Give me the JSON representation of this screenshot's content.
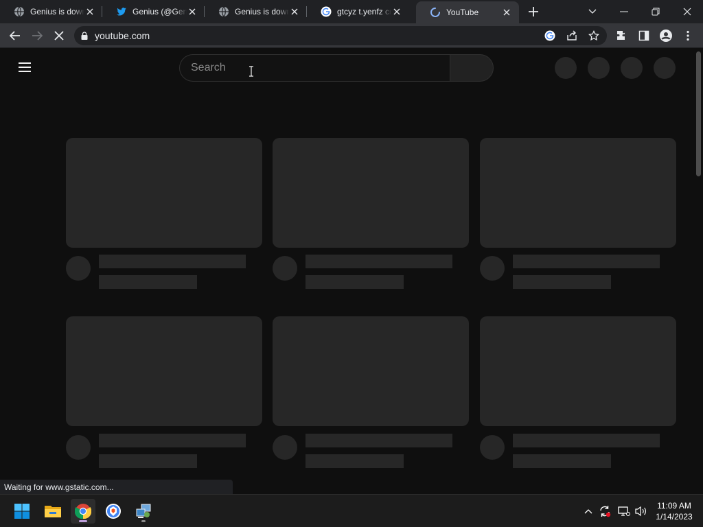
{
  "browser": {
    "tabs": [
      {
        "title": "Genius is down",
        "icon": "globe-icon"
      },
      {
        "title": "Genius (@Genius) / Twitter",
        "icon": "twitter-icon"
      },
      {
        "title": "Genius is down",
        "icon": "globe-icon"
      },
      {
        "title": "gtcyz t.yenfz crfs",
        "icon": "google-icon"
      },
      {
        "title": "YouTube",
        "icon": "loading-spinner-icon",
        "active": true
      }
    ],
    "address": "youtube.com",
    "status_text": "Waiting for www.gstatic.com..."
  },
  "youtube": {
    "search_placeholder": "Search"
  },
  "taskbar": {
    "time": "11:09 AM",
    "date": "1/14/2023",
    "apps": [
      "windows-start-icon",
      "file-explorer-icon",
      "chrome-icon",
      "brave-icon",
      "network-app-icon"
    ]
  },
  "colors": {
    "page_bg": "#0f0f0f",
    "skeleton": "#272727",
    "tabstrip_bg": "#202124",
    "toolbar_bg": "#35363a"
  }
}
